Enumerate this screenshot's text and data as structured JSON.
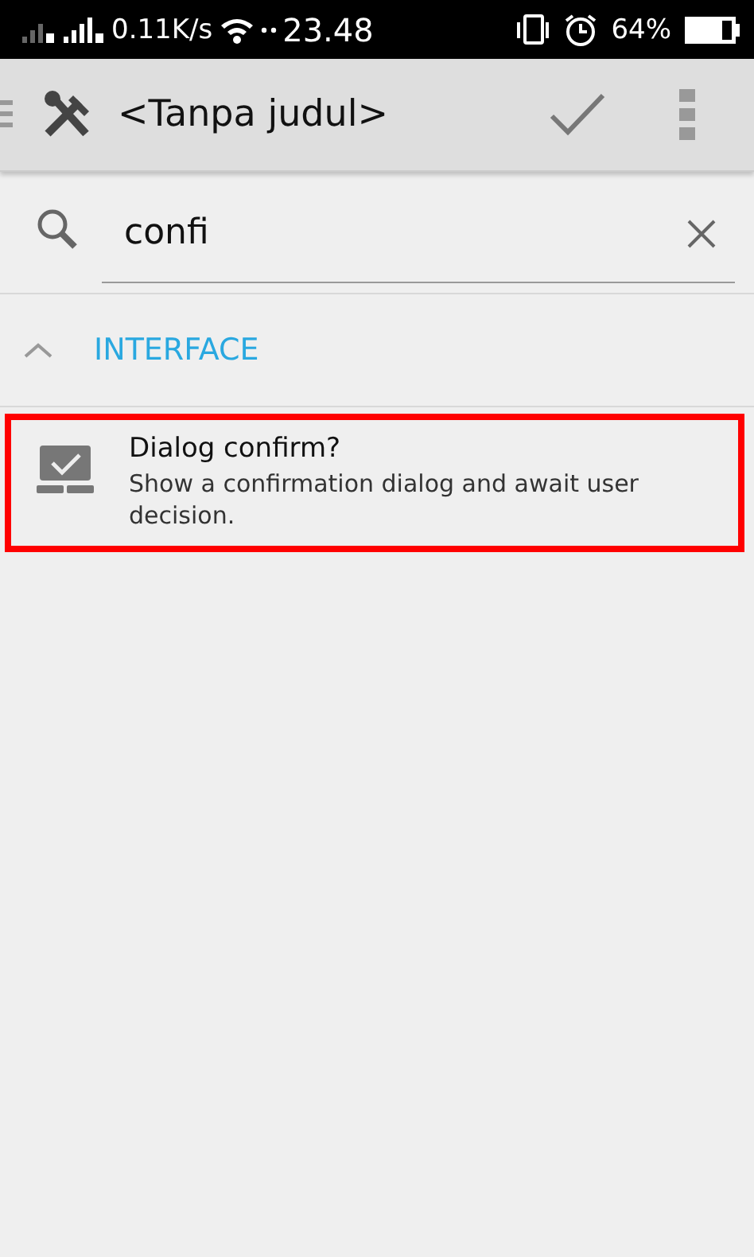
{
  "status_bar": {
    "speed": "0.11K/s",
    "time": "23.48",
    "battery": "64%"
  },
  "toolbar": {
    "title": "<Tanpa judul>"
  },
  "search": {
    "value": "confi"
  },
  "section": {
    "title": "INTERFACE",
    "expanded": true
  },
  "items": [
    {
      "title": "Dialog confirm?",
      "description": "Show a confirmation dialog and await user decision.",
      "highlighted": true
    }
  ]
}
